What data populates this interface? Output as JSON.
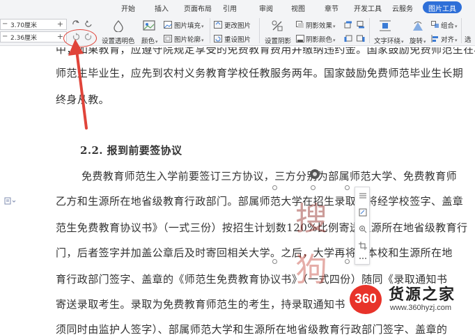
{
  "ribbon": {
    "tabs": [
      "开始",
      "插入",
      "页面布局",
      "引用",
      "审阅",
      "视图",
      "章节",
      "开发工具",
      "云服务",
      "图片工具"
    ],
    "active_tab": "图片工具",
    "accent_color": "#2e6fd8",
    "height_value": "3.70厘米",
    "width_value": "2.36厘米",
    "labels": {
      "set_transparent": "设置透明色",
      "color": "颜色",
      "picture_fill": "图片填充",
      "picture_outline": "图片轮廓",
      "change_picture": "更改图片",
      "reset_picture": "重设图片",
      "set_shadow": "设置阴影",
      "shadow_effect": "阴影效果",
      "shadow_color": "阴影颜色",
      "text_wrap": "文字环绕",
      "rotate": "旋转",
      "group": "组合",
      "align": "对齐",
      "select": "选"
    }
  },
  "document": {
    "lines": {
      "l0": "中，如果教育，应遵守院规定享受的免费教育费用并缴纳违约金。国家鼓励免费师范生在校",
      "l1": "师范生毕业生，应先到农村义务教育学校任教服务两年。国家鼓励免费师范毕业生长期",
      "l2": "终身从教。",
      "heading": "2.2. 报到前要签协议",
      "p1": "免费教育师范生入学前要签订三方协议，三方分别为部属师范大学、免费教育师",
      "p2": "乙方和生源所在地省级教育行政部门。部属师范大学在招生录取前将经学校签字、盖章",
      "p3": "范生免费教育协议书》（一式三份）按招生计划数120%比例寄送生源所在地省级教育行",
      "p4": "门，后者签字并加盖公章后及时寄回相关大学。之后，大学再将由本校和生源所在地",
      "p5": "育行政部门签字、盖章的《师范生免费教育协议书》（一式四份）随同《录取通知书",
      "p6": "寄送录取考生。录取为免费教育师范生的考生，持录取通知书",
      "p7": "须同时由监护人签字）、部属师范大学和生源所在地省级教育行政部门签字、盖章的"
    }
  },
  "watermark": {
    "text": "搜狗",
    "color": "#c0392b"
  },
  "logo": {
    "number": "360",
    "name": "货源之家",
    "url": "www.360hyzj.com",
    "color": "#e8332a"
  }
}
